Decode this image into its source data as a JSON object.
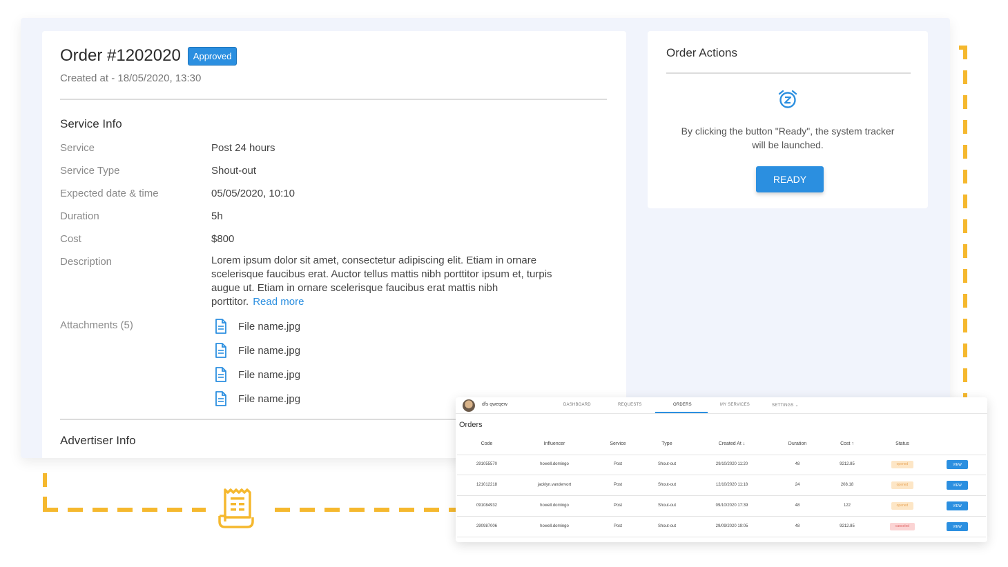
{
  "order": {
    "title": "Order #1202020",
    "status_badge": "Approved",
    "created": "Created at - 18/05/2020, 13:30"
  },
  "service_info": {
    "title": "Service Info",
    "rows": [
      {
        "label": "Service",
        "value": "Post 24 hours"
      },
      {
        "label": "Service Type",
        "value": "Shout-out"
      },
      {
        "label": "Expected date & time",
        "value": "05/05/2020, 10:10"
      },
      {
        "label": "Duration",
        "value": "5h"
      },
      {
        "label": "Cost",
        "value": "$800"
      }
    ],
    "description_label": "Description",
    "description": "Lorem ipsum dolor sit amet, consectetur adipiscing elit. Etiam in ornare scelerisque faucibus erat. Auctor tellus mattis nibh porttitor ipsum et, turpis augue ut. Etiam in ornare scelerisque faucibus erat mattis nibh porttitor.",
    "read_more": "Read more",
    "attachments_label": "Attachments (5)",
    "attachments": [
      "File name.jpg",
      "File name.jpg",
      "File name.jpg",
      "File name.jpg"
    ],
    "file_icon": "document-icon"
  },
  "advertiser_info": {
    "title": "Advertiser Info"
  },
  "order_actions": {
    "title": "Order Actions",
    "icon": "alarm-clock-icon",
    "text": "By clicking the button \"Ready\", the system tracker will be launched.",
    "button": "READY"
  },
  "orders_panel": {
    "user": "dfs qweqew",
    "nav": [
      "DASHBOARD",
      "REQUESTS",
      "ORDERS",
      "MY SERVICES",
      "SETTINGS ⌄"
    ],
    "active_nav": "ORDERS",
    "title": "Orders",
    "columns": [
      "Code",
      "Influencer",
      "Service",
      "Type",
      "Created At ↓",
      "Duration",
      "Cost ↑",
      "Status"
    ],
    "rows": [
      {
        "code": "291055570",
        "influencer": "howell.domingo",
        "service": "Post",
        "type": "Shout-out",
        "created": "29/10/2020 11:20",
        "duration": "48",
        "cost": "9212.85",
        "status": "opened",
        "action": "VIEW"
      },
      {
        "code": "121012218",
        "influencer": "jacklyn.vandervort",
        "service": "Post",
        "type": "Shout-out",
        "created": "12/10/2020 11:18",
        "duration": "24",
        "cost": "208.18",
        "status": "opened",
        "action": "VIEW"
      },
      {
        "code": "091084932",
        "influencer": "howell.domingo",
        "service": "Post",
        "type": "Shout-out",
        "created": "09/10/2020 17:39",
        "duration": "48",
        "cost": "122",
        "status": "opened",
        "action": "VIEW"
      },
      {
        "code": "290987006",
        "influencer": "howell.domingo",
        "service": "Post",
        "type": "Shout-out",
        "created": "29/09/2020 19:05",
        "duration": "48",
        "cost": "9212.85",
        "status": "canceled",
        "action": "VIEW"
      }
    ]
  },
  "colors": {
    "accent": "#2b8fe0",
    "dash": "#f5b82e"
  }
}
